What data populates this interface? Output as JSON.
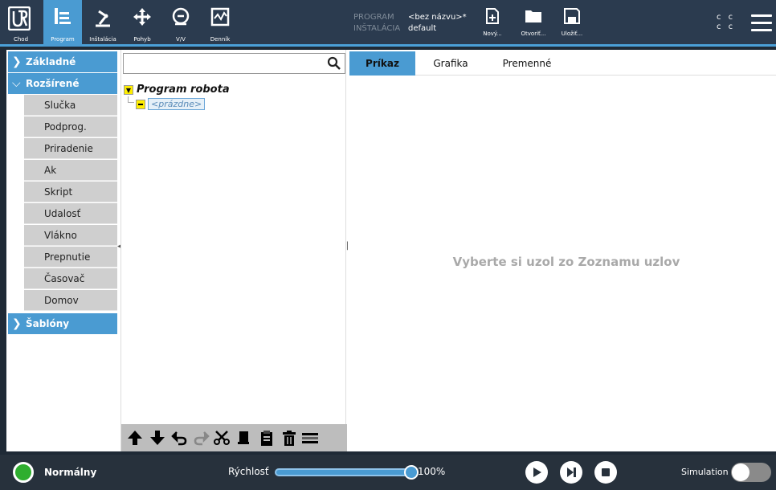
{
  "header": {
    "nav": [
      {
        "label": "Chod"
      },
      {
        "label": "Program"
      },
      {
        "label": "Inštalácia"
      },
      {
        "label": "Pohyb"
      },
      {
        "label": "V/V"
      },
      {
        "label": "Denník"
      }
    ],
    "program_key": "PROGRAM",
    "program_value": "<bez názvu>*",
    "installation_key": "INŠTALÁCIA",
    "installation_value": "default",
    "file_buttons": [
      {
        "label": "Nový..."
      },
      {
        "label": "Otvoriť..."
      },
      {
        "label": "Uložiť..."
      }
    ],
    "cc_top": "c c",
    "cc_bottom": "c c"
  },
  "sidebar": {
    "basic": "Základné",
    "advanced": "Rozšírené",
    "items": [
      {
        "label": "Slučka"
      },
      {
        "label": "Podprog."
      },
      {
        "label": "Priradenie"
      },
      {
        "label": "Ak"
      },
      {
        "label": "Skript"
      },
      {
        "label": "Udalosť"
      },
      {
        "label": "Vlákno"
      },
      {
        "label": "Prepnutie"
      },
      {
        "label": "Časovač"
      },
      {
        "label": "Domov"
      }
    ],
    "templates": "Šablóny"
  },
  "tree": {
    "root": "Program robota",
    "child": "<prázdne>"
  },
  "right": {
    "tabs": [
      {
        "label": "Príkaz"
      },
      {
        "label": "Grafika"
      },
      {
        "label": "Premenné"
      }
    ],
    "hint": "Vyberte si uzol zo Zoznamu uzlov"
  },
  "footer": {
    "status": "Normálny",
    "speed_label": "Rýchlosť",
    "speed_value": "100%",
    "speed_fraction": 1.0,
    "simulation_label": "Simulation",
    "accent": "#4a9bd2",
    "status_color": "#2fae2f"
  }
}
